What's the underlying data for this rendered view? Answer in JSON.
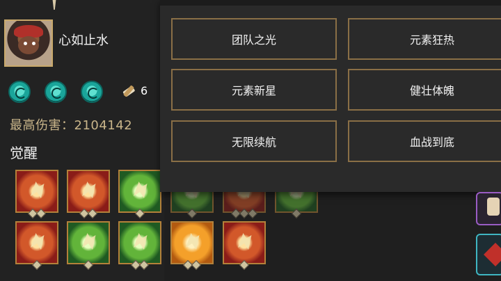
{
  "player": {
    "name": "心如止水",
    "item_count": "6",
    "max_damage": "最高伤害：2104142"
  },
  "awaken": {
    "title": "觉醒"
  },
  "skills": [
    "teal-skill-icon",
    "teal-skill-icon",
    "teal-skill-icon"
  ],
  "buff_rows": [
    [
      {
        "color": "red",
        "pips": 2
      },
      {
        "color": "red",
        "pips": 2
      },
      {
        "color": "green",
        "pips": 1
      },
      {
        "color": "green",
        "pips": 1
      },
      {
        "color": "red",
        "pips": 3
      },
      {
        "color": "green",
        "pips": 1
      }
    ],
    [
      {
        "color": "red",
        "pips": 1
      },
      {
        "color": "green",
        "pips": 1
      },
      {
        "color": "green",
        "pips": 2
      },
      {
        "color": "gold",
        "pips": 2
      },
      {
        "color": "red",
        "pips": 1
      }
    ]
  ],
  "options": [
    {
      "label": "团队之光"
    },
    {
      "label": "元素狂热"
    },
    {
      "label": "元素新星"
    },
    {
      "label": "健壮体魄"
    },
    {
      "label": "无限续航"
    },
    {
      "label": "血战到底"
    }
  ],
  "colors": {
    "border_gold": "#8a6f46",
    "damage_text": "#c9b58a",
    "panel_bg": "#2a2a2a"
  }
}
